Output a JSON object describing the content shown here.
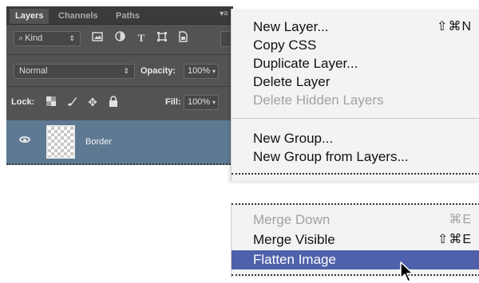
{
  "layers_panel": {
    "tabs": [
      "Layers",
      "Channels",
      "Paths"
    ],
    "filter": {
      "glyph": "⌕",
      "label": "Kind",
      "arrow": "⇕"
    },
    "filter_icons": [
      "image-filter-icon",
      "adjustment-filter-icon",
      "type-filter-icon",
      "shape-filter-icon",
      "smart-object-filter-icon"
    ],
    "blend_mode": "Normal",
    "opacity_label": "Opacity:",
    "opacity_value": "100%",
    "lock_label": "Lock:",
    "fill_label": "Fill:",
    "fill_value": "100%",
    "layer": {
      "name": "Border"
    }
  },
  "context_menu": {
    "group1": [
      {
        "label": "New Layer...",
        "shortcut": "⇧⌘N",
        "disabled": false
      },
      {
        "label": "Copy CSS",
        "shortcut": "",
        "disabled": false
      },
      {
        "label": "Duplicate Layer...",
        "shortcut": "",
        "disabled": false
      },
      {
        "label": "Delete Layer",
        "shortcut": "",
        "disabled": false
      },
      {
        "label": "Delete Hidden Layers",
        "shortcut": "",
        "disabled": true
      }
    ],
    "group2": [
      {
        "label": "New Group...",
        "shortcut": "",
        "disabled": false
      },
      {
        "label": "New Group from Layers...",
        "shortcut": "",
        "disabled": false
      }
    ],
    "group3": [
      {
        "label": "Merge Down",
        "shortcut": "⌘E",
        "disabled": true
      },
      {
        "label": "Merge Visible",
        "shortcut": "⇧⌘E",
        "disabled": false
      },
      {
        "label": "Flatten Image",
        "shortcut": "",
        "disabled": false,
        "highlighted": true
      }
    ]
  },
  "colors": {
    "panel": "#535353",
    "selected_layer": "#5e7a93",
    "menu_bg": "#f3f3f3",
    "menu_highlight": "#4e61aa"
  }
}
